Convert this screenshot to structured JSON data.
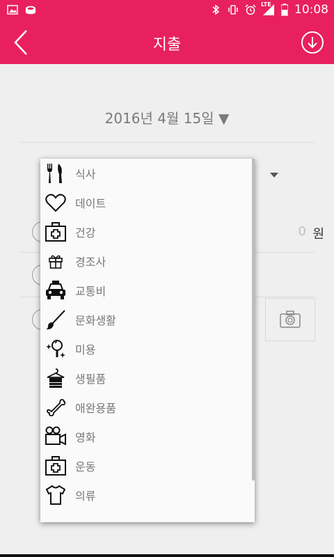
{
  "status": {
    "time": "10:08",
    "network": "LTE"
  },
  "header": {
    "title": "지출"
  },
  "date_selector": {
    "value": "2016년 4월 15일 ▼"
  },
  "amount": {
    "value": "0",
    "unit": "원"
  },
  "category_menu": {
    "items": [
      {
        "label": "식사",
        "icon": "fork-knife-icon"
      },
      {
        "label": "데이트",
        "icon": "heart-icon"
      },
      {
        "label": "건강",
        "icon": "medical-kit-icon"
      },
      {
        "label": "경조사",
        "icon": "gift-icon"
      },
      {
        "label": "교통비",
        "icon": "taxi-icon"
      },
      {
        "label": "문화생활",
        "icon": "brush-icon"
      },
      {
        "label": "미용",
        "icon": "mirror-icon"
      },
      {
        "label": "생필품",
        "icon": "towel-hanger-icon"
      },
      {
        "label": "애완용품",
        "icon": "bone-icon"
      },
      {
        "label": "영화",
        "icon": "movie-camera-icon"
      },
      {
        "label": "운동",
        "icon": "medical-kit-icon"
      },
      {
        "label": "의류",
        "icon": "tshirt-icon"
      }
    ]
  }
}
